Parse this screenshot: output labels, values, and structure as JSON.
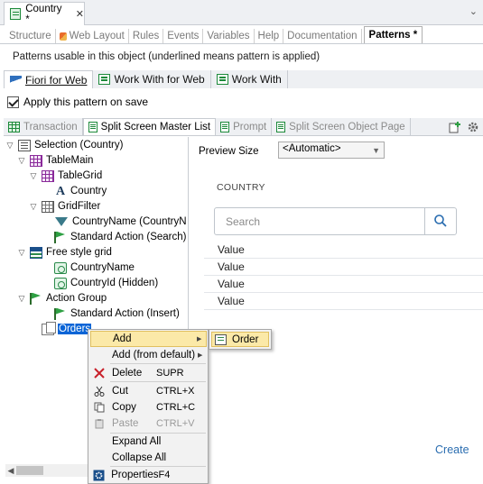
{
  "document_tab": {
    "title": "Country *",
    "close_glyph": "✕"
  },
  "tab_menu_glyph": "⌄",
  "sub_tabs": [
    "Structure",
    "Web Layout",
    "Rules",
    "Events",
    "Variables",
    "Help",
    "Documentation",
    "Patterns *"
  ],
  "patterns_info": "Patterns usable in this object (underlined means pattern is applied)",
  "pattern_tabs": [
    {
      "label": "Fiori for Web",
      "selected": true
    },
    {
      "label": "Work With for Web",
      "selected": false
    },
    {
      "label": "Work With",
      "selected": false
    }
  ],
  "apply_pattern": {
    "label": "Apply this pattern on save",
    "checked": true
  },
  "instance_tabs": [
    {
      "label": "Transaction",
      "selected": false
    },
    {
      "label": "Split Screen Master List",
      "selected": true
    },
    {
      "label": "Prompt",
      "selected": false
    },
    {
      "label": "Split Screen Object Page",
      "selected": false
    }
  ],
  "tree": {
    "nodes": [
      {
        "label": "Selection (Country)",
        "icon": "selection-icon"
      },
      {
        "label": "TableMain",
        "icon": "table-icon"
      },
      {
        "label": "TableGrid",
        "icon": "table-icon"
      },
      {
        "label": "Country",
        "icon": "attribute-icon"
      },
      {
        "label": "GridFilter",
        "icon": "grid-icon"
      },
      {
        "label": "CountryName (CountryN",
        "icon": "filter-icon"
      },
      {
        "label": "Standard Action (Search)",
        "icon": "flag-icon"
      },
      {
        "label": "Free style grid",
        "icon": "freestyle-grid-icon"
      },
      {
        "label": "CountryName",
        "icon": "control-icon"
      },
      {
        "label": "CountryId (Hidden)",
        "icon": "control-icon"
      },
      {
        "label": "Action Group",
        "icon": "flag-icon"
      },
      {
        "label": "Standard Action (Insert)",
        "icon": "flag-icon"
      },
      {
        "label": "Orders",
        "icon": "orders-icon"
      }
    ]
  },
  "preview": {
    "size_label": "Preview Size",
    "size_value": "<Automatic>",
    "entity_title": "COUNTRY",
    "search_placeholder": "Search",
    "rows": [
      "Value",
      "Value",
      "Value",
      "Value"
    ],
    "create_label": "Create"
  },
  "context_menu": {
    "items": [
      {
        "label": "Add",
        "shortcut": "",
        "submenu": true
      },
      {
        "label": "Add (from default)",
        "shortcut": "",
        "submenu": true
      },
      {
        "label": "Delete",
        "shortcut": "SUPR"
      },
      {
        "label": "Cut",
        "shortcut": "CTRL+X"
      },
      {
        "label": "Copy",
        "shortcut": "CTRL+C"
      },
      {
        "label": "Paste",
        "shortcut": "CTRL+V"
      },
      {
        "label": "Expand All",
        "shortcut": ""
      },
      {
        "label": "Collapse All",
        "shortcut": ""
      },
      {
        "label": "Properties",
        "shortcut": "F4"
      }
    ]
  },
  "submenu": {
    "item_label": "Order"
  }
}
